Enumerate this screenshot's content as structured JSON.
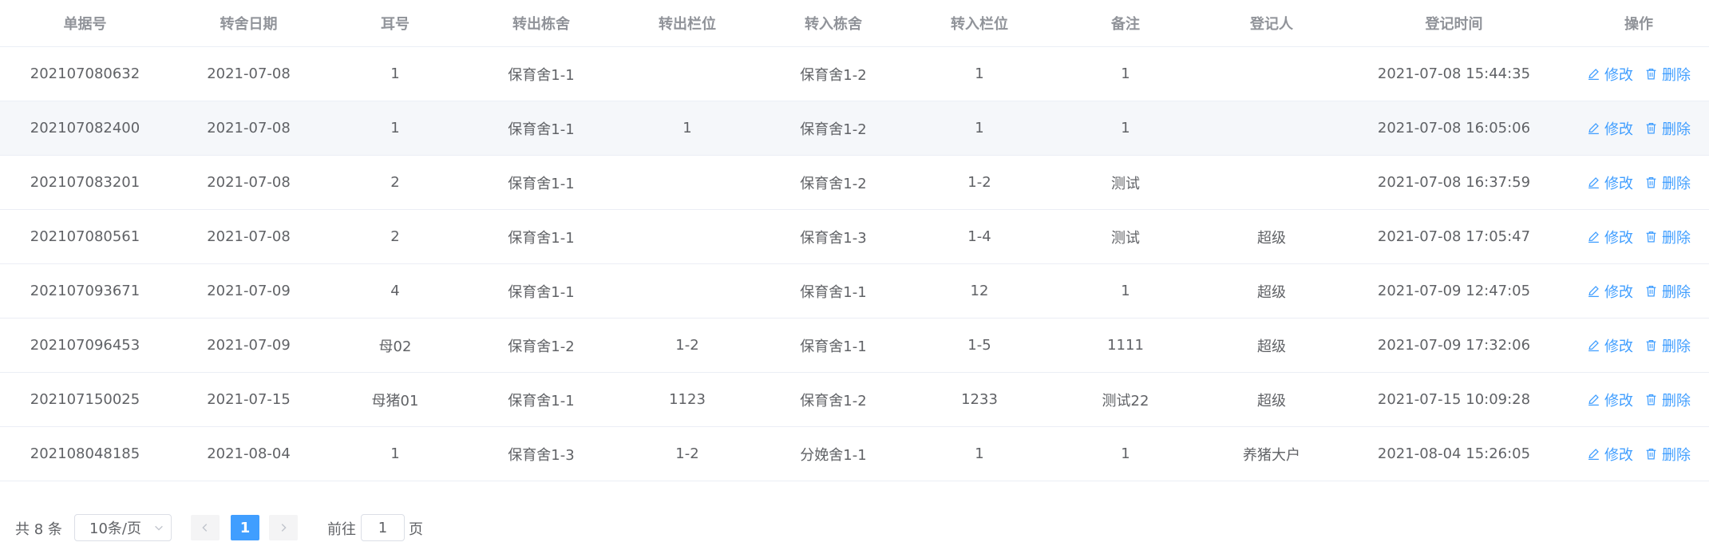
{
  "table": {
    "headers": [
      "单据号",
      "转舍日期",
      "耳号",
      "转出栋舍",
      "转出栏位",
      "转入栋舍",
      "转入栏位",
      "备注",
      "登记人",
      "登记时间",
      "操作"
    ],
    "rows": [
      {
        "id": "202107080632",
        "date": "2021-07-08",
        "ear": "1",
        "out_house": "保育舍1-1",
        "out_pen": "",
        "in_house": "保育舍1-2",
        "in_pen": "1",
        "note": "1",
        "registrar": "",
        "time": "2021-07-08 15:44:35"
      },
      {
        "id": "202107082400",
        "date": "2021-07-08",
        "ear": "1",
        "out_house": "保育舍1-1",
        "out_pen": "1",
        "in_house": "保育舍1-2",
        "in_pen": "1",
        "note": "1",
        "registrar": "",
        "time": "2021-07-08 16:05:06"
      },
      {
        "id": "202107083201",
        "date": "2021-07-08",
        "ear": "2",
        "out_house": "保育舍1-1",
        "out_pen": "",
        "in_house": "保育舍1-2",
        "in_pen": "1-2",
        "note": "测试",
        "registrar": "",
        "time": "2021-07-08 16:37:59"
      },
      {
        "id": "202107080561",
        "date": "2021-07-08",
        "ear": "2",
        "out_house": "保育舍1-1",
        "out_pen": "",
        "in_house": "保育舍1-3",
        "in_pen": "1-4",
        "note": "测试",
        "registrar": "超级",
        "time": "2021-07-08 17:05:47"
      },
      {
        "id": "202107093671",
        "date": "2021-07-09",
        "ear": "4",
        "out_house": "保育舍1-1",
        "out_pen": "",
        "in_house": "保育舍1-1",
        "in_pen": "12",
        "note": "1",
        "registrar": "超级",
        "time": "2021-07-09 12:47:05"
      },
      {
        "id": "202107096453",
        "date": "2021-07-09",
        "ear": "母02",
        "out_house": "保育舍1-2",
        "out_pen": "1-2",
        "in_house": "保育舍1-1",
        "in_pen": "1-5",
        "note": "1111",
        "registrar": "超级",
        "time": "2021-07-09 17:32:06"
      },
      {
        "id": "202107150025",
        "date": "2021-07-15",
        "ear": "母猪01",
        "out_house": "保育舍1-1",
        "out_pen": "1123",
        "in_house": "保育舍1-2",
        "in_pen": "1233",
        "note": "测试22",
        "registrar": "超级",
        "time": "2021-07-15 10:09:28"
      },
      {
        "id": "202108048185",
        "date": "2021-08-04",
        "ear": "1",
        "out_house": "保育舍1-3",
        "out_pen": "1-2",
        "in_house": "分娩舍1-1",
        "in_pen": "1",
        "note": "1",
        "registrar": "养猪大户",
        "time": "2021-08-04 15:26:05"
      }
    ],
    "actions": {
      "edit_label": "修改",
      "delete_label": "删除",
      "edit_icon": "edit-icon",
      "delete_icon": "trash-icon"
    }
  },
  "pagination": {
    "total_label": "共 8 条",
    "page_size": "10条/页",
    "current_page": "1",
    "goto_label": "前往",
    "goto_value": "1",
    "page_unit": "页"
  },
  "colors": {
    "accent": "#409eff",
    "header_text": "#909399",
    "body_text": "#606266",
    "stripe": "#f5f7fa",
    "border": "#ebeef5"
  }
}
